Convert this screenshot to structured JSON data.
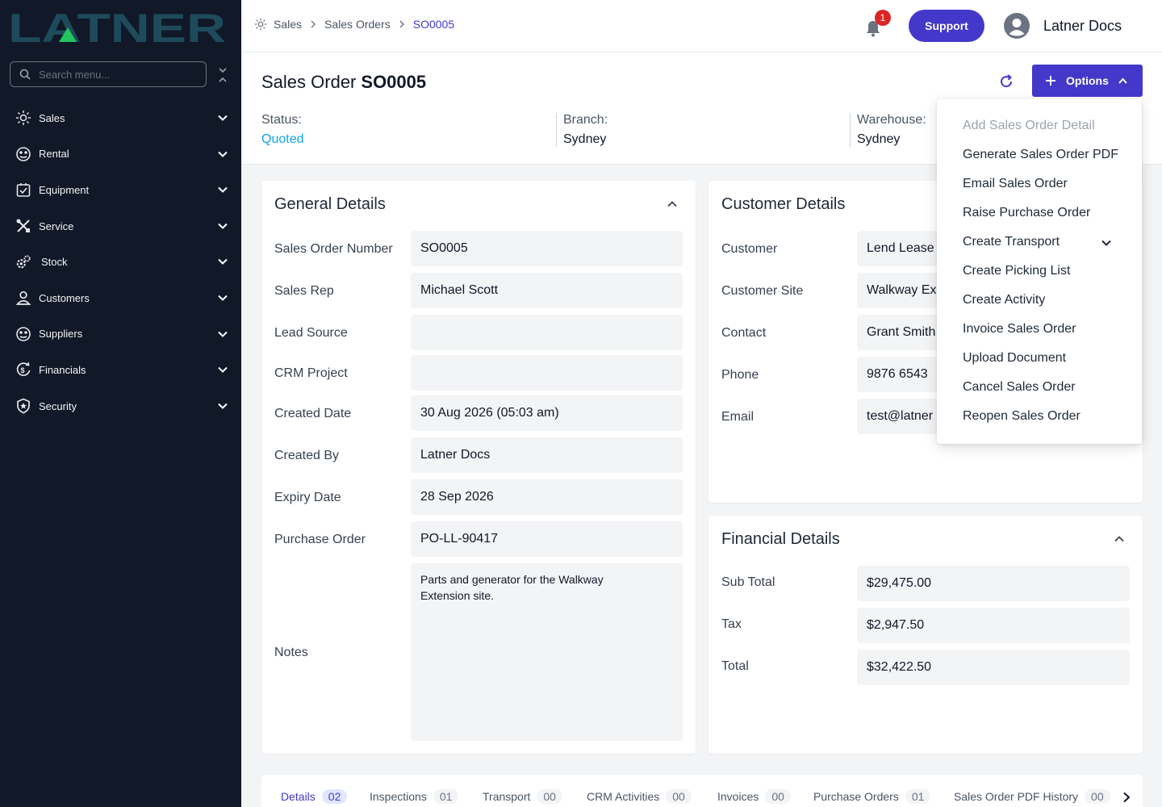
{
  "sidebar": {
    "logo_text": "LATNER",
    "search_placeholder": "Search menu...",
    "items": [
      {
        "label": "Sales",
        "icon": "sales-icon"
      },
      {
        "label": "Rental",
        "icon": "rental-icon"
      },
      {
        "label": "Equipment",
        "icon": "equipment-icon"
      },
      {
        "label": "Service",
        "icon": "service-icon"
      },
      {
        "label": "Stock",
        "icon": "stock-icon"
      },
      {
        "label": "Customers",
        "icon": "customers-icon"
      },
      {
        "label": "Suppliers",
        "icon": "suppliers-icon"
      },
      {
        "label": "Financials",
        "icon": "financials-icon"
      },
      {
        "label": "Security",
        "icon": "security-icon"
      }
    ]
  },
  "topbar": {
    "breadcrumb": [
      "Sales",
      "Sales Orders",
      "SO0005"
    ],
    "notification_count": "1",
    "support_label": "Support",
    "user_name": "Latner Docs"
  },
  "header": {
    "title_prefix": "Sales Order",
    "title_id": "SO0005",
    "options_label": "Options",
    "status_label": "Status:",
    "status_value": "Quoted",
    "branch_label": "Branch:",
    "branch_value": "Sydney",
    "warehouse_label": "Warehouse:",
    "warehouse_value": "Sydney"
  },
  "general": {
    "title": "General Details",
    "rows": [
      {
        "label": "Sales Order Number",
        "value": "SO0005"
      },
      {
        "label": "Sales Rep",
        "value": "Michael Scott"
      },
      {
        "label": "Lead Source",
        "value": ""
      },
      {
        "label": "CRM Project",
        "value": ""
      },
      {
        "label": "Created Date",
        "value": "30 Aug 2026 (05:03 am)"
      },
      {
        "label": "Created By",
        "value": "Latner Docs"
      },
      {
        "label": "Expiry Date",
        "value": "28 Sep 2026"
      },
      {
        "label": "Purchase Order",
        "value": "PO-LL-90417"
      }
    ],
    "notes_label": "Notes",
    "notes_value": "Parts and generator for the Walkway Extension site."
  },
  "customer": {
    "title": "Customer Details",
    "rows": [
      {
        "label": "Customer",
        "value": "Lend Lease"
      },
      {
        "label": "Customer Site",
        "value": "Walkway Ex"
      },
      {
        "label": "Contact",
        "value": "Grant Smith"
      },
      {
        "label": "Phone",
        "value": "9876 6543"
      },
      {
        "label": "Email",
        "value": "test@latner"
      }
    ]
  },
  "financial": {
    "title": "Financial Details",
    "rows": [
      {
        "label": "Sub Total",
        "value": "$29,475.00"
      },
      {
        "label": "Tax",
        "value": "$2,947.50"
      },
      {
        "label": "Total",
        "value": "$32,422.50"
      }
    ]
  },
  "tabs": [
    {
      "label": "Details",
      "count": "02"
    },
    {
      "label": "Inspections",
      "count": "01"
    },
    {
      "label": "Transport",
      "count": "00"
    },
    {
      "label": "CRM Activities",
      "count": "00"
    },
    {
      "label": "Invoices",
      "count": "00"
    },
    {
      "label": "Purchase Orders",
      "count": "01"
    },
    {
      "label": "Sales Order PDF History",
      "count": "00"
    }
  ],
  "options_menu": [
    {
      "label": "Add Sales Order Detail",
      "disabled": true
    },
    {
      "label": "Generate Sales Order PDF"
    },
    {
      "label": "Email Sales Order"
    },
    {
      "label": "Raise Purchase Order"
    },
    {
      "label": "Create Transport",
      "submenu": true
    },
    {
      "label": "Create Picking List"
    },
    {
      "label": "Create Activity"
    },
    {
      "label": "Invoice Sales Order"
    },
    {
      "label": "Upload Document"
    },
    {
      "label": "Cancel Sales Order"
    },
    {
      "label": "Reopen Sales Order"
    }
  ],
  "colors": {
    "sidebar_bg": "#111827",
    "accent": "#4338ca",
    "status_quoted": "#0ea5e9",
    "logo_teal": "#1e4b5c",
    "logo_green": "#22c55e",
    "badge_red": "#dc2626"
  }
}
